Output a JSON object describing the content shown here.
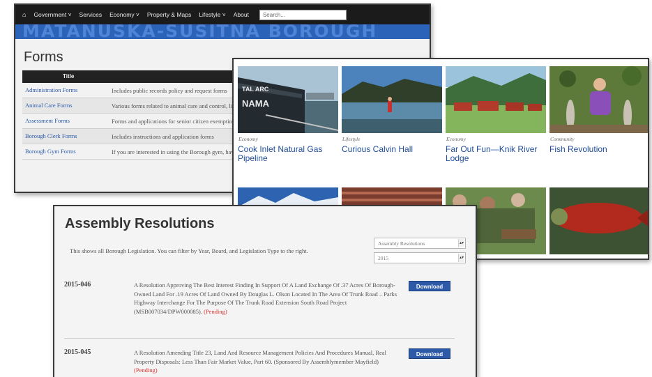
{
  "forms_window": {
    "nav": {
      "home_glyph": "⌂",
      "items": [
        "Government ˅",
        "Services",
        "Economy ˅",
        "Property & Maps",
        "Lifestyle ˅",
        "About"
      ],
      "search_placeholder": "Search..."
    },
    "banner": "MATANUSKA-SUSITNA BOROUGH",
    "title": "Forms",
    "table": {
      "header": "Title",
      "rows": [
        {
          "link": "Administration Forms",
          "desc": "Includes public records policy and request forms"
        },
        {
          "link": "Animal Care Forms",
          "desc": "Various forms related to animal care and control, licensing, and other animal-related items"
        },
        {
          "link": "Assessment Forms",
          "desc": "Forms and applications for senior citizen exemptions, business inventory, and fire relief."
        },
        {
          "link": "Borough Clerk Forms",
          "desc": "Includes instructions and application forms"
        },
        {
          "link": "Borough Gym Forms",
          "desc": "If you are interested in using the Borough gym, have general questions, please call or"
        }
      ]
    }
  },
  "stories_window": {
    "cards": [
      {
        "category": "Economy",
        "title": "Cook Inlet Natural Gas Pipeline",
        "photo_text": "TAL ARC\nNAMA"
      },
      {
        "category": "Lifestyle",
        "title": "Curious Calvin Hall"
      },
      {
        "category": "Economy",
        "title": "Far Out Fun—Knik River Lodge"
      },
      {
        "category": "Community",
        "title": "Fish Revolution"
      }
    ]
  },
  "resolutions_window": {
    "title": "Assembly Resolutions",
    "intro": "This shows all Borough Legislation. You can filter by Year, Board, and Legislation Type to the right.",
    "filters": {
      "type": "Assembly Resolutions",
      "year": "2015"
    },
    "items": [
      {
        "number": "2015-046",
        "text": "A Resolution Approving The Best Interest Finding In Support Of A Land Exchange Of .37 Acres Of Borough-Owned Land For .19 Acres Of Land Owned By Douglas L. Olson Located In The Area Of Trunk Road – Parks Highway Interchange For The Purpose Of The Trunk Road Extension South Road Project (MSB007034/DPW000085).",
        "status": "(Pending)",
        "button": "Download"
      },
      {
        "number": "2015-045",
        "text": "A Resolution Amending Title 23, Land And Resource Management Policies And Procedures Manual, Real Property Disposals: Less Than Fair Market Value, Part 60. (Sponsored By Assemblymember Mayfield)",
        "status": "(Pending)",
        "button": "Download"
      }
    ]
  }
}
